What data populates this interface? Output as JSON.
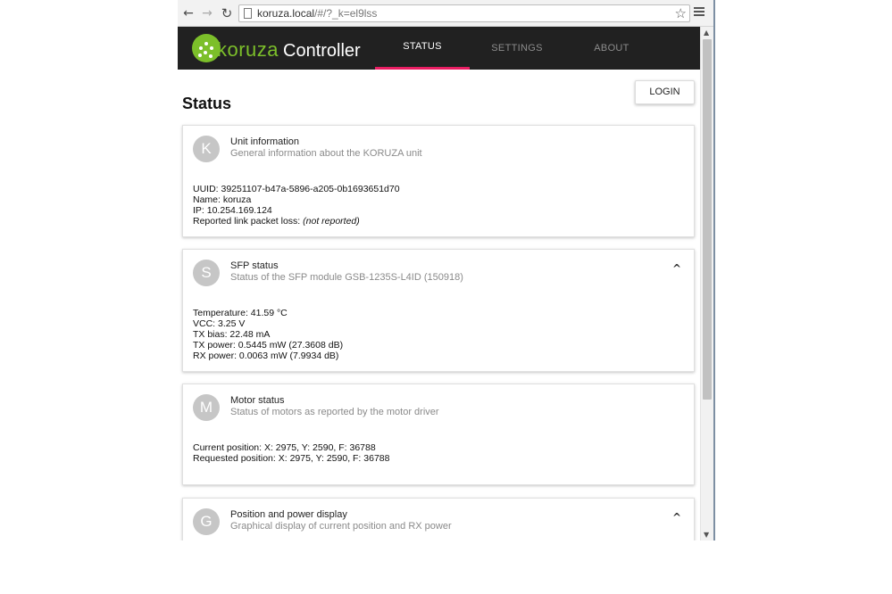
{
  "browser": {
    "url_host": "koruza.local",
    "url_path": "/#/?_k=el9lss"
  },
  "app": {
    "brand": "koruza",
    "title": "Controller",
    "tabs": [
      {
        "label": "STATUS",
        "active": true
      },
      {
        "label": "SETTINGS",
        "active": false
      },
      {
        "label": "ABOUT",
        "active": false
      }
    ],
    "accent_color": "#e91e63",
    "brand_color": "#7cbf2a"
  },
  "page": {
    "title": "Status",
    "login_label": "LOGIN"
  },
  "cards": {
    "unit": {
      "letter": "K",
      "title": "Unit information",
      "subtitle": "General information about the KORUZA unit",
      "uuid": "UUID: 39251107-b47a-5896-a205-0b1693651d70",
      "name": "Name: koruza",
      "ip": "IP: 10.254.169.124",
      "loss_label": "Reported link packet loss: ",
      "loss_value": "(not reported)"
    },
    "sfp": {
      "letter": "S",
      "title": "SFP status",
      "subtitle": "Status of the SFP module GSB-1235S-L4ID (150918)",
      "temperature": "Temperature: 41.59 °C",
      "vcc": "VCC: 3.25 V",
      "tx_bias": "TX bias: 22.48 mA",
      "tx_power": "TX power: 0.5445 mW (27.3608 dB)",
      "rx_power": "RX power: 0.0063 mW (7.9934 dB)",
      "caret": "^"
    },
    "motor": {
      "letter": "M",
      "title": "Motor status",
      "subtitle": "Status of motors as reported by the motor driver",
      "current": "Current position: X: 2975, Y: 2590, F: 36788",
      "requested": "Requested position: X: 2975, Y: 2590, F: 36788"
    },
    "display": {
      "letter": "G",
      "title": "Position and power display",
      "subtitle": "Graphical display of current position and RX power",
      "caret": "^"
    }
  }
}
